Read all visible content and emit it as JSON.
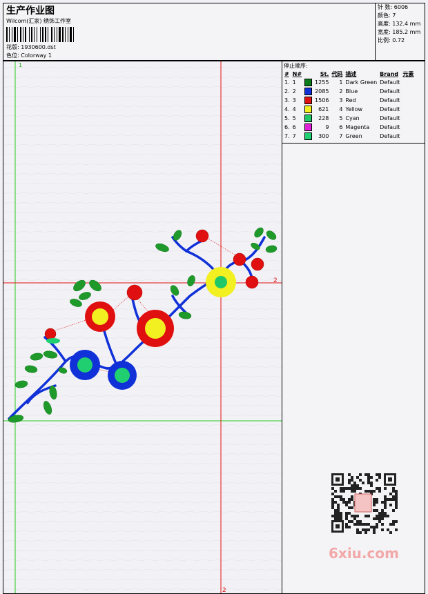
{
  "header": {
    "title": "生产作业图",
    "subtitle": "Wilcom(汇家) 绣饰工作室",
    "design_label": "花版:",
    "design_value": "1930600.dst",
    "colorway_label": "色位:",
    "colorway_value": "Colorway 1"
  },
  "stats": {
    "stitches": "针 数: 6006",
    "colors": "颜色: 7",
    "height": "高度: 132.4 mm",
    "width": "宽度: 185.2 mm",
    "scale": "比例: 0.72"
  },
  "stop_sequence": {
    "title": "停止顺序:",
    "headers": [
      "#",
      "N#",
      "St.",
      "代码",
      "描述",
      "Brand",
      "元素"
    ],
    "rows": [
      {
        "idx": "1.",
        "n": "1",
        "st": "1255",
        "code": "1",
        "desc": "Dark Green",
        "brand": "Default",
        "color": "#0a7a1a"
      },
      {
        "idx": "2.",
        "n": "2",
        "st": "2085",
        "code": "2",
        "desc": "Blue",
        "brand": "Default",
        "color": "#1030d8"
      },
      {
        "idx": "3.",
        "n": "3",
        "st": "1506",
        "code": "3",
        "desc": "Red",
        "brand": "Default",
        "color": "#e01010"
      },
      {
        "idx": "4.",
        "n": "4",
        "st": "621",
        "code": "4",
        "desc": "Yellow",
        "brand": "Default",
        "color": "#f2f020"
      },
      {
        "idx": "5.",
        "n": "5",
        "st": "228",
        "code": "5",
        "desc": "Cyan",
        "brand": "Default",
        "color": "#20c868"
      },
      {
        "idx": "6.",
        "n": "6",
        "st": "9",
        "code": "6",
        "desc": "Magenta",
        "brand": "Default",
        "color": "#e020d8"
      },
      {
        "idx": "7.",
        "n": "7",
        "st": "300",
        "code": "7",
        "desc": "Green",
        "brand": "Default",
        "color": "#20d070"
      }
    ]
  },
  "canvas": {
    "marker_1": "1",
    "marker_2_right": "2",
    "marker_2_bottom": "2"
  },
  "watermark": {
    "site": "6xiu.com"
  }
}
